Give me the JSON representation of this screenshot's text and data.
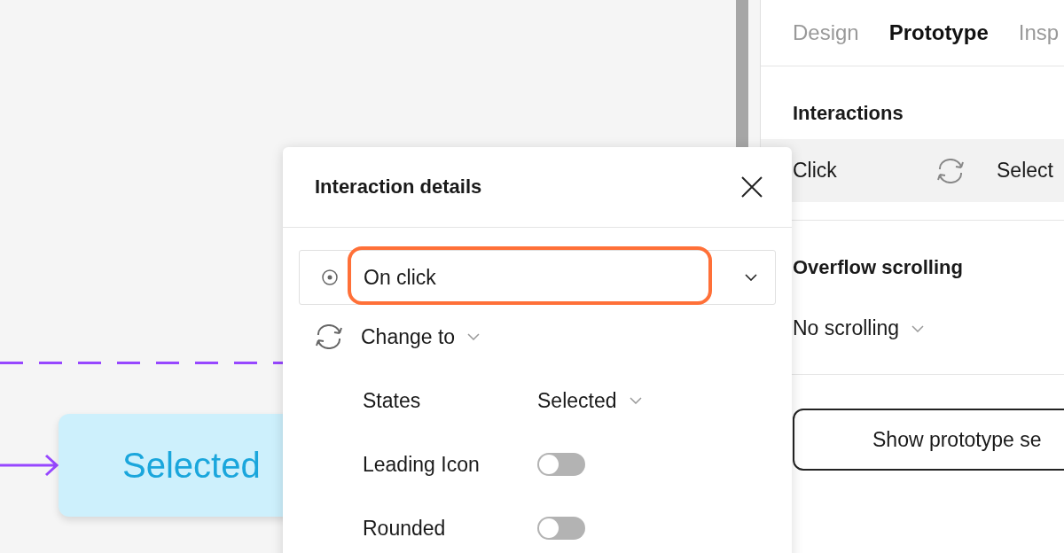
{
  "canvas": {
    "component_label": "Selected"
  },
  "panel": {
    "tabs": [
      {
        "label": "Design",
        "selected": false
      },
      {
        "label": "Prototype",
        "selected": true
      },
      {
        "label": "Insp",
        "selected": false
      }
    ],
    "interactions": {
      "title": "Interactions",
      "items": [
        {
          "trigger": "Click",
          "target": "Select"
        }
      ]
    },
    "overflow": {
      "title": "Overflow scrolling",
      "value": "No scrolling"
    },
    "settings_button": "Show prototype se"
  },
  "dialog": {
    "title": "Interaction details",
    "trigger": "On click",
    "action": "Change to",
    "properties": [
      {
        "kind": "dropdown",
        "label": "States",
        "value": "Selected"
      },
      {
        "kind": "toggle",
        "label": "Leading Icon",
        "on": false
      },
      {
        "kind": "toggle",
        "label": "Rounded",
        "on": false
      }
    ]
  }
}
